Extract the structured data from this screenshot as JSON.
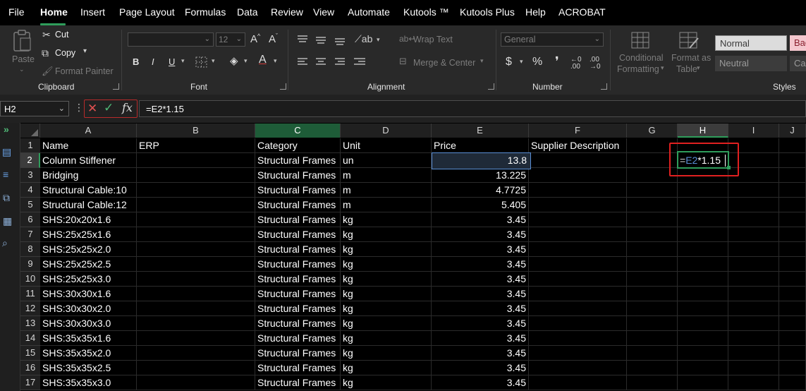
{
  "menu": [
    "File",
    "Home",
    "Insert",
    "Page Layout",
    "Formulas",
    "Data",
    "Review",
    "View",
    "Automate",
    "Kutools ™",
    "Kutools Plus",
    "Help",
    "ACROBAT"
  ],
  "ribbon": {
    "clipboard": {
      "paste": "Paste",
      "cut": "Cut",
      "copy": "Copy",
      "format_painter": "Format Painter",
      "label": "Clipboard"
    },
    "font": {
      "size": "12",
      "grow": "A^",
      "shrink": "Aˇ",
      "bold": "B",
      "italic": "I",
      "underline": "U",
      "label": "Font"
    },
    "alignment": {
      "wrap_text": "Wrap Text",
      "merge_center": "Merge & Center",
      "label": "Alignment"
    },
    "number": {
      "format": "General",
      "currency": "$",
      "percent": "%",
      "comma": "❜",
      "label": "Number"
    },
    "styles": {
      "conditional": "Conditional",
      "formatting": "Formatting",
      "format_as": "Format as",
      "table": "Table",
      "normal": "Normal",
      "neutral": "Neutral",
      "bad": "Bad",
      "calc": "Cal",
      "label": "Styles"
    }
  },
  "formula_bar": {
    "name_box": "H2",
    "formula": "=E2*1.15"
  },
  "columns": [
    "A",
    "B",
    "C",
    "D",
    "E",
    "F",
    "G",
    "H",
    "I",
    "J"
  ],
  "rows": [
    "1",
    "2",
    "3",
    "4",
    "5",
    "6",
    "7",
    "8",
    "9",
    "10",
    "11",
    "12",
    "13",
    "14",
    "15",
    "16",
    "17"
  ],
  "sheet": [
    [
      "Name",
      "ERP",
      "Category",
      "Unit",
      "Price",
      "Supplier Description"
    ],
    [
      "Column Stiffener",
      "",
      "Structural Frames",
      "un",
      "13.8",
      ""
    ],
    [
      "Bridging",
      "",
      "Structural Frames",
      "m",
      "13.225",
      ""
    ],
    [
      "Structural Cable:10",
      "",
      "Structural Frames",
      "m",
      "4.7725",
      ""
    ],
    [
      "Structural Cable:12",
      "",
      "Structural Frames",
      "m",
      "5.405",
      ""
    ],
    [
      "SHS:20x20x1.6",
      "",
      "Structural Frames",
      "kg",
      "3.45",
      ""
    ],
    [
      "SHS:25x25x1.6",
      "",
      "Structural Frames",
      "kg",
      "3.45",
      ""
    ],
    [
      "SHS:25x25x2.0",
      "",
      "Structural Frames",
      "kg",
      "3.45",
      ""
    ],
    [
      "SHS:25x25x2.5",
      "",
      "Structural Frames",
      "kg",
      "3.45",
      ""
    ],
    [
      "SHS:25x25x3.0",
      "",
      "Structural Frames",
      "kg",
      "3.45",
      ""
    ],
    [
      "SHS:30x30x1.6",
      "",
      "Structural Frames",
      "kg",
      "3.45",
      ""
    ],
    [
      "SHS:30x30x2.0",
      "",
      "Structural Frames",
      "kg",
      "3.45",
      ""
    ],
    [
      "SHS:30x30x3.0",
      "",
      "Structural Frames",
      "kg",
      "3.45",
      ""
    ],
    [
      "SHS:35x35x1.6",
      "",
      "Structural Frames",
      "kg",
      "3.45",
      ""
    ],
    [
      "SHS:35x35x2.0",
      "",
      "Structural Frames",
      "kg",
      "3.45",
      ""
    ],
    [
      "SHS:35x35x2.5",
      "",
      "Structural Frames",
      "kg",
      "3.45",
      ""
    ],
    [
      "SHS:35x35x3.0",
      "",
      "Structural Frames",
      "kg",
      "3.45",
      ""
    ]
  ],
  "active_cell": {
    "ref_part": "E2",
    "rest": "*1.15",
    "eq": "="
  },
  "colors": {
    "accent": "#2f9d5b",
    "ref_blue": "#5a8fd6",
    "highlight_red": "#e02020"
  }
}
